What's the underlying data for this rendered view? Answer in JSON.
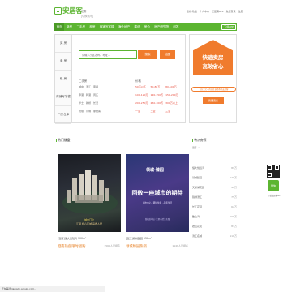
{
  "header": {
    "logo_text": "安居客",
    "city": "江阴",
    "city_sub": "[切换城市]",
    "user_links": [
      "您好,欢迎",
      "个人中心",
      "安居客APP",
      "免费登录",
      "注册"
    ]
  },
  "nav": {
    "items": [
      "首页",
      "新房",
      "二手房",
      "租房",
      "商铺写字楼",
      "海外地产",
      "楼讯",
      "房价",
      "房产研究院",
      "问答"
    ],
    "active_index": 0,
    "right_button": "下载APP"
  },
  "side_tabs": [
    "买 房",
    "卖 房",
    "租 房",
    "商铺写字楼",
    "厂房仓库"
  ],
  "search": {
    "placeholder": "请输入小区名称、地址...",
    "search_button": "搜索",
    "map_button": "地图"
  },
  "filters": {
    "area": {
      "head": "二手房",
      "items": [
        "城中",
        "澄江",
        "南闸",
        "申港",
        "利港",
        "周庄",
        "华士",
        "新桥",
        "长泾",
        "祝塘",
        "月城",
        "徐霞客"
      ]
    },
    "price": {
      "head": "价格",
      "items": [
        "50万以下",
        "50-80万",
        "80-100万",
        "100-120万",
        "120-150万",
        "150-200万",
        "200-250万",
        "250-300万",
        "300万以上",
        "一室",
        "二室",
        "三室"
      ]
    }
  },
  "promo": {
    "line1": "快速卖房",
    "line2": "高效省心",
    "tag": "百分之七十的业主选择委托安居客",
    "button": "我要卖房"
  },
  "hot": {
    "title": "热门楼盘",
    "cards": [
      {
        "image_caption_line1": "城市门户",
        "image_caption_line2": "江阴 核心区域 品质人居",
        "caption": "[澄南]恒大悦珑湾 100m²",
        "cta": "澄南热盘限时团购",
        "count": "1566人已报名"
      },
      {
        "image_logo": "领城·臻园",
        "image_banner": "回敬一座城市的期待",
        "image_sub": "城市中心 · 稀缺住宅 · 品质生活",
        "image_foot": "售楼处地址: 江阴市澄江东路",
        "caption": "[澄江]领城臻园 136m²",
        "cta": "领城臻园热销",
        "count": "1148人已报名"
      }
    ]
  },
  "right_section": {
    "title": "特价房源",
    "subtitle": "更多 >",
    "rows": [
      {
        "name": "恒大悦珑湾",
        "detail": "89万"
      },
      {
        "name": "领城臻园",
        "detail": "126万"
      },
      {
        "name": "天鹅湖花园",
        "detail": "98万"
      },
      {
        "name": "锦绣澄江",
        "detail": "75万"
      },
      {
        "name": "长江花园",
        "detail": "62万"
      },
      {
        "name": "敔山湾",
        "detail": "108万"
      },
      {
        "name": "君山花苑",
        "detail": "83万"
      },
      {
        "name": "滨江名城",
        "detail": "116万"
      }
    ]
  },
  "qr": {
    "wx_label": "微信",
    "caption": "下载安居客APP"
  },
  "status_bar": "正在等待 jiangyin.anjuke.com..."
}
